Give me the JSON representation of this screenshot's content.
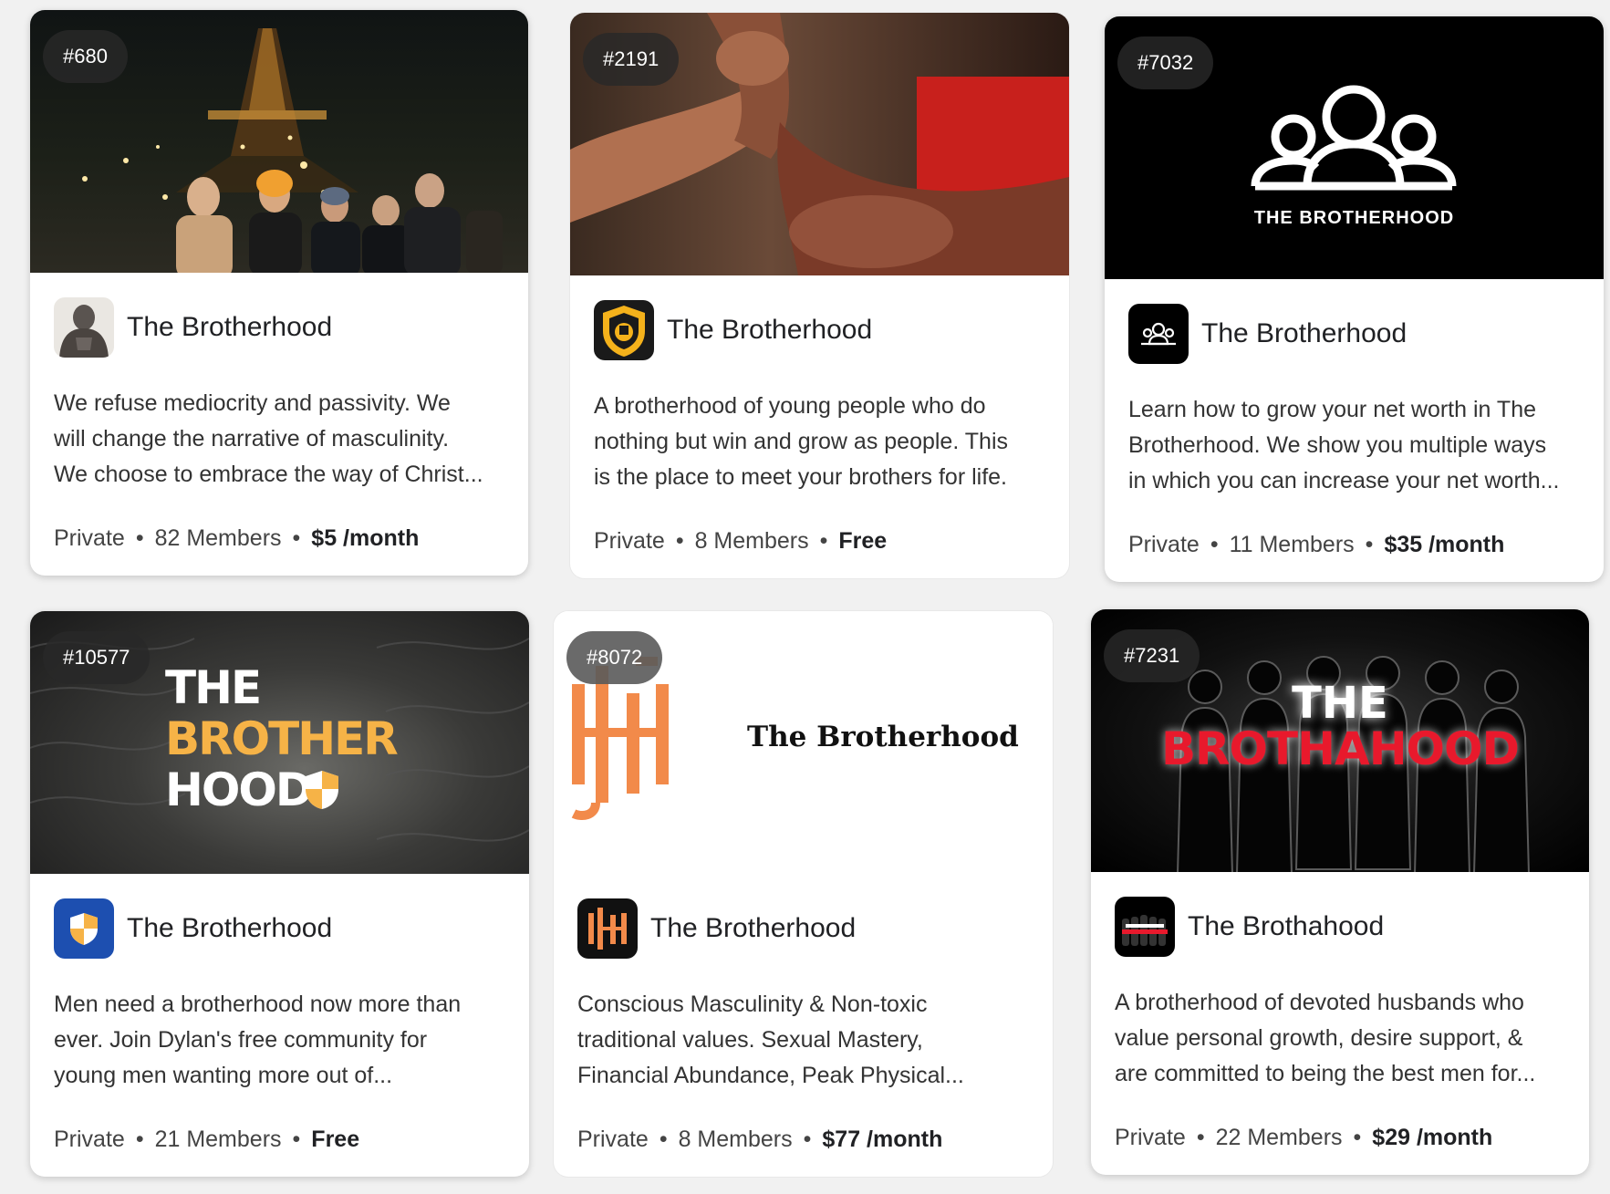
{
  "cards": [
    {
      "rank": "#680",
      "name": "The Brotherhood",
      "desc_lines": [
        "We refuse mediocrity and passivity. We",
        "will change the narrative of masculinity.",
        "We choose to embrace the way of Christ..."
      ],
      "privacy": "Private",
      "members": "82 Members",
      "price": "$5 /month"
    },
    {
      "rank": "#2191",
      "name": "The Brotherhood",
      "desc_lines": [
        "A brotherhood of young people who do",
        "nothing but win and grow as people. This",
        "is the place to meet your brothers for life."
      ],
      "privacy": "Private",
      "members": "8 Members",
      "price": "Free"
    },
    {
      "rank": "#7032",
      "name": "The Brotherhood",
      "cover_text": "THE BROTHERHOOD",
      "desc_lines": [
        "Learn how to grow your net worth in The",
        "Brotherhood. We show you multiple ways",
        "in which you can increase your net worth..."
      ],
      "privacy": "Private",
      "members": "11 Members",
      "price": "$35 /month"
    },
    {
      "rank": "#10577",
      "name": "The Brotherhood",
      "cover_lines": [
        "THE",
        "BROTHER",
        "HOOD"
      ],
      "desc_lines": [
        "Men need a brotherhood now more than",
        "ever. Join Dylan's free community for",
        "young men wanting more out of..."
      ],
      "privacy": "Private",
      "members": "21 Members",
      "price": "Free"
    },
    {
      "rank": "#8072",
      "name": "The Brotherhood",
      "cover_text": "The Brotherhood",
      "desc_lines": [
        "Conscious Masculinity & Non-toxic",
        "traditional values. Sexual Mastery,",
        "Financial Abundance, Peak Physical..."
      ],
      "privacy": "Private",
      "members": "8 Members",
      "price": "$77 /month"
    },
    {
      "rank": "#7231",
      "name": "The Brothahood",
      "cover_lines": [
        "THE",
        "BROTHAHOOD"
      ],
      "desc_lines": [
        "A brotherhood of devoted husbands who",
        "value personal growth, desire support, &",
        "are committed to being the best men for..."
      ],
      "privacy": "Private",
      "members": "22 Members",
      "price": "$29 /month"
    }
  ],
  "separator": "•",
  "colors": {
    "page_bg": "#f1f1f1",
    "badge_bg": "#282828",
    "shield_gold": "#f5b21b",
    "shield_blue": "#1d4fb0",
    "brothahood_red": "#e8192c",
    "monogram_orange": "#f28a4a"
  }
}
